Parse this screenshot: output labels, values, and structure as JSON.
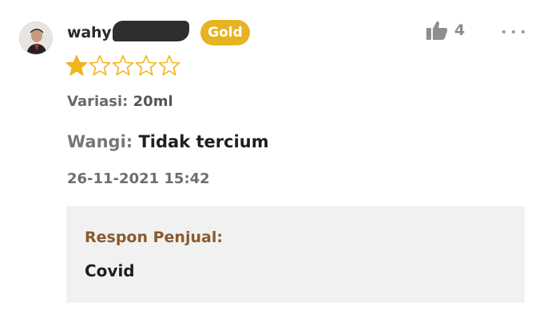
{
  "review": {
    "username": "wahy",
    "badge": "Gold",
    "likes": "4",
    "rating": 1,
    "max_rating": 5,
    "variasi_label": "Variasi:",
    "variasi_value": "20ml",
    "wangi_label": "Wangi:",
    "wangi_value": "Tidak tercium",
    "date": "26-11-2021 15:42"
  },
  "seller_response": {
    "title": "Respon Penjual:",
    "text": "Covid"
  },
  "colors": {
    "badge": "#e7b321",
    "star": "#f0b41c",
    "response_title": "#8a5a2b",
    "response_bg": "#f1f1f1"
  },
  "icons": {
    "like": "thumbs-up-icon",
    "more": "more-dots-icon",
    "star": "star-icon"
  }
}
